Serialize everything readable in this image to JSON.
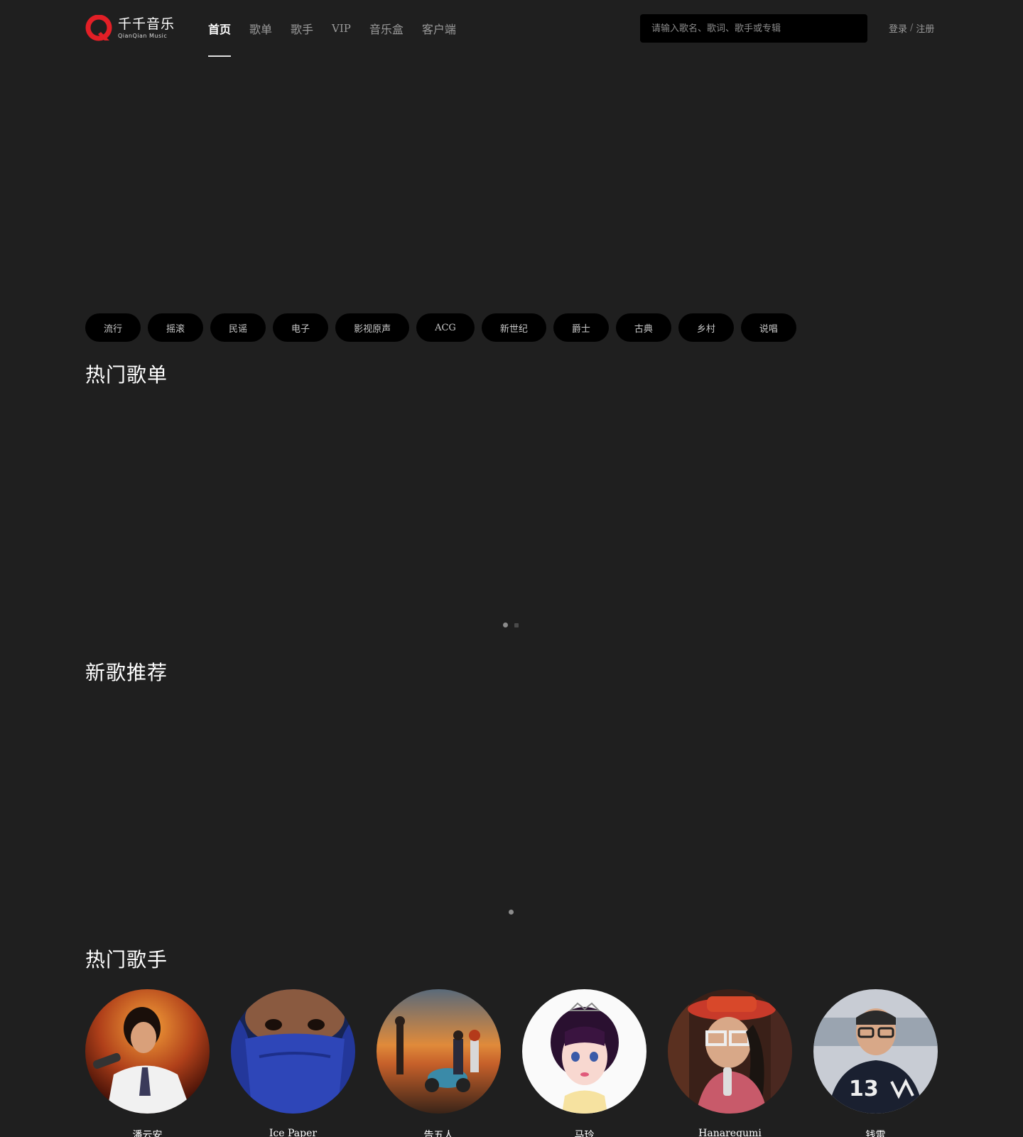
{
  "brand": {
    "name_cn": "千千音乐",
    "name_en": "QianQian Music",
    "accent": "#e21f26"
  },
  "nav": {
    "items": [
      {
        "label": "首页",
        "active": true
      },
      {
        "label": "歌单",
        "active": false
      },
      {
        "label": "歌手",
        "active": false
      },
      {
        "label": "VIP",
        "active": false
      },
      {
        "label": "音乐盒",
        "active": false
      },
      {
        "label": "客户端",
        "active": false
      }
    ]
  },
  "search": {
    "placeholder": "请输入歌名、歌词、歌手或专辑",
    "value": ""
  },
  "auth": {
    "login": "登录",
    "separator": "/",
    "register": "注册"
  },
  "genres": [
    "流行",
    "摇滚",
    "民谣",
    "电子",
    "影视原声",
    "ACG",
    "新世纪",
    "爵士",
    "古典",
    "乡村",
    "说唱"
  ],
  "sections": {
    "hot_playlists": "热门歌单",
    "new_songs": "新歌推荐",
    "hot_singers": "热门歌手"
  },
  "carousel": {
    "playlists_pages": 2,
    "playlists_active": 1,
    "newsongs_pages": 1,
    "newsongs_active": 1
  },
  "singers": [
    {
      "name": "潘云安",
      "icon": "singer-on-stage-avatar"
    },
    {
      "name": "Ice Paper",
      "icon": "masked-face-avatar"
    },
    {
      "name": "告五人",
      "icon": "band-scooter-sunset-avatar"
    },
    {
      "name": "马玲",
      "icon": "girl-tiara-avatar"
    },
    {
      "name": "Hanaregumi",
      "icon": "red-hat-glasses-avatar"
    },
    {
      "name": "钱雷",
      "icon": "man-glasses-avatar"
    }
  ]
}
